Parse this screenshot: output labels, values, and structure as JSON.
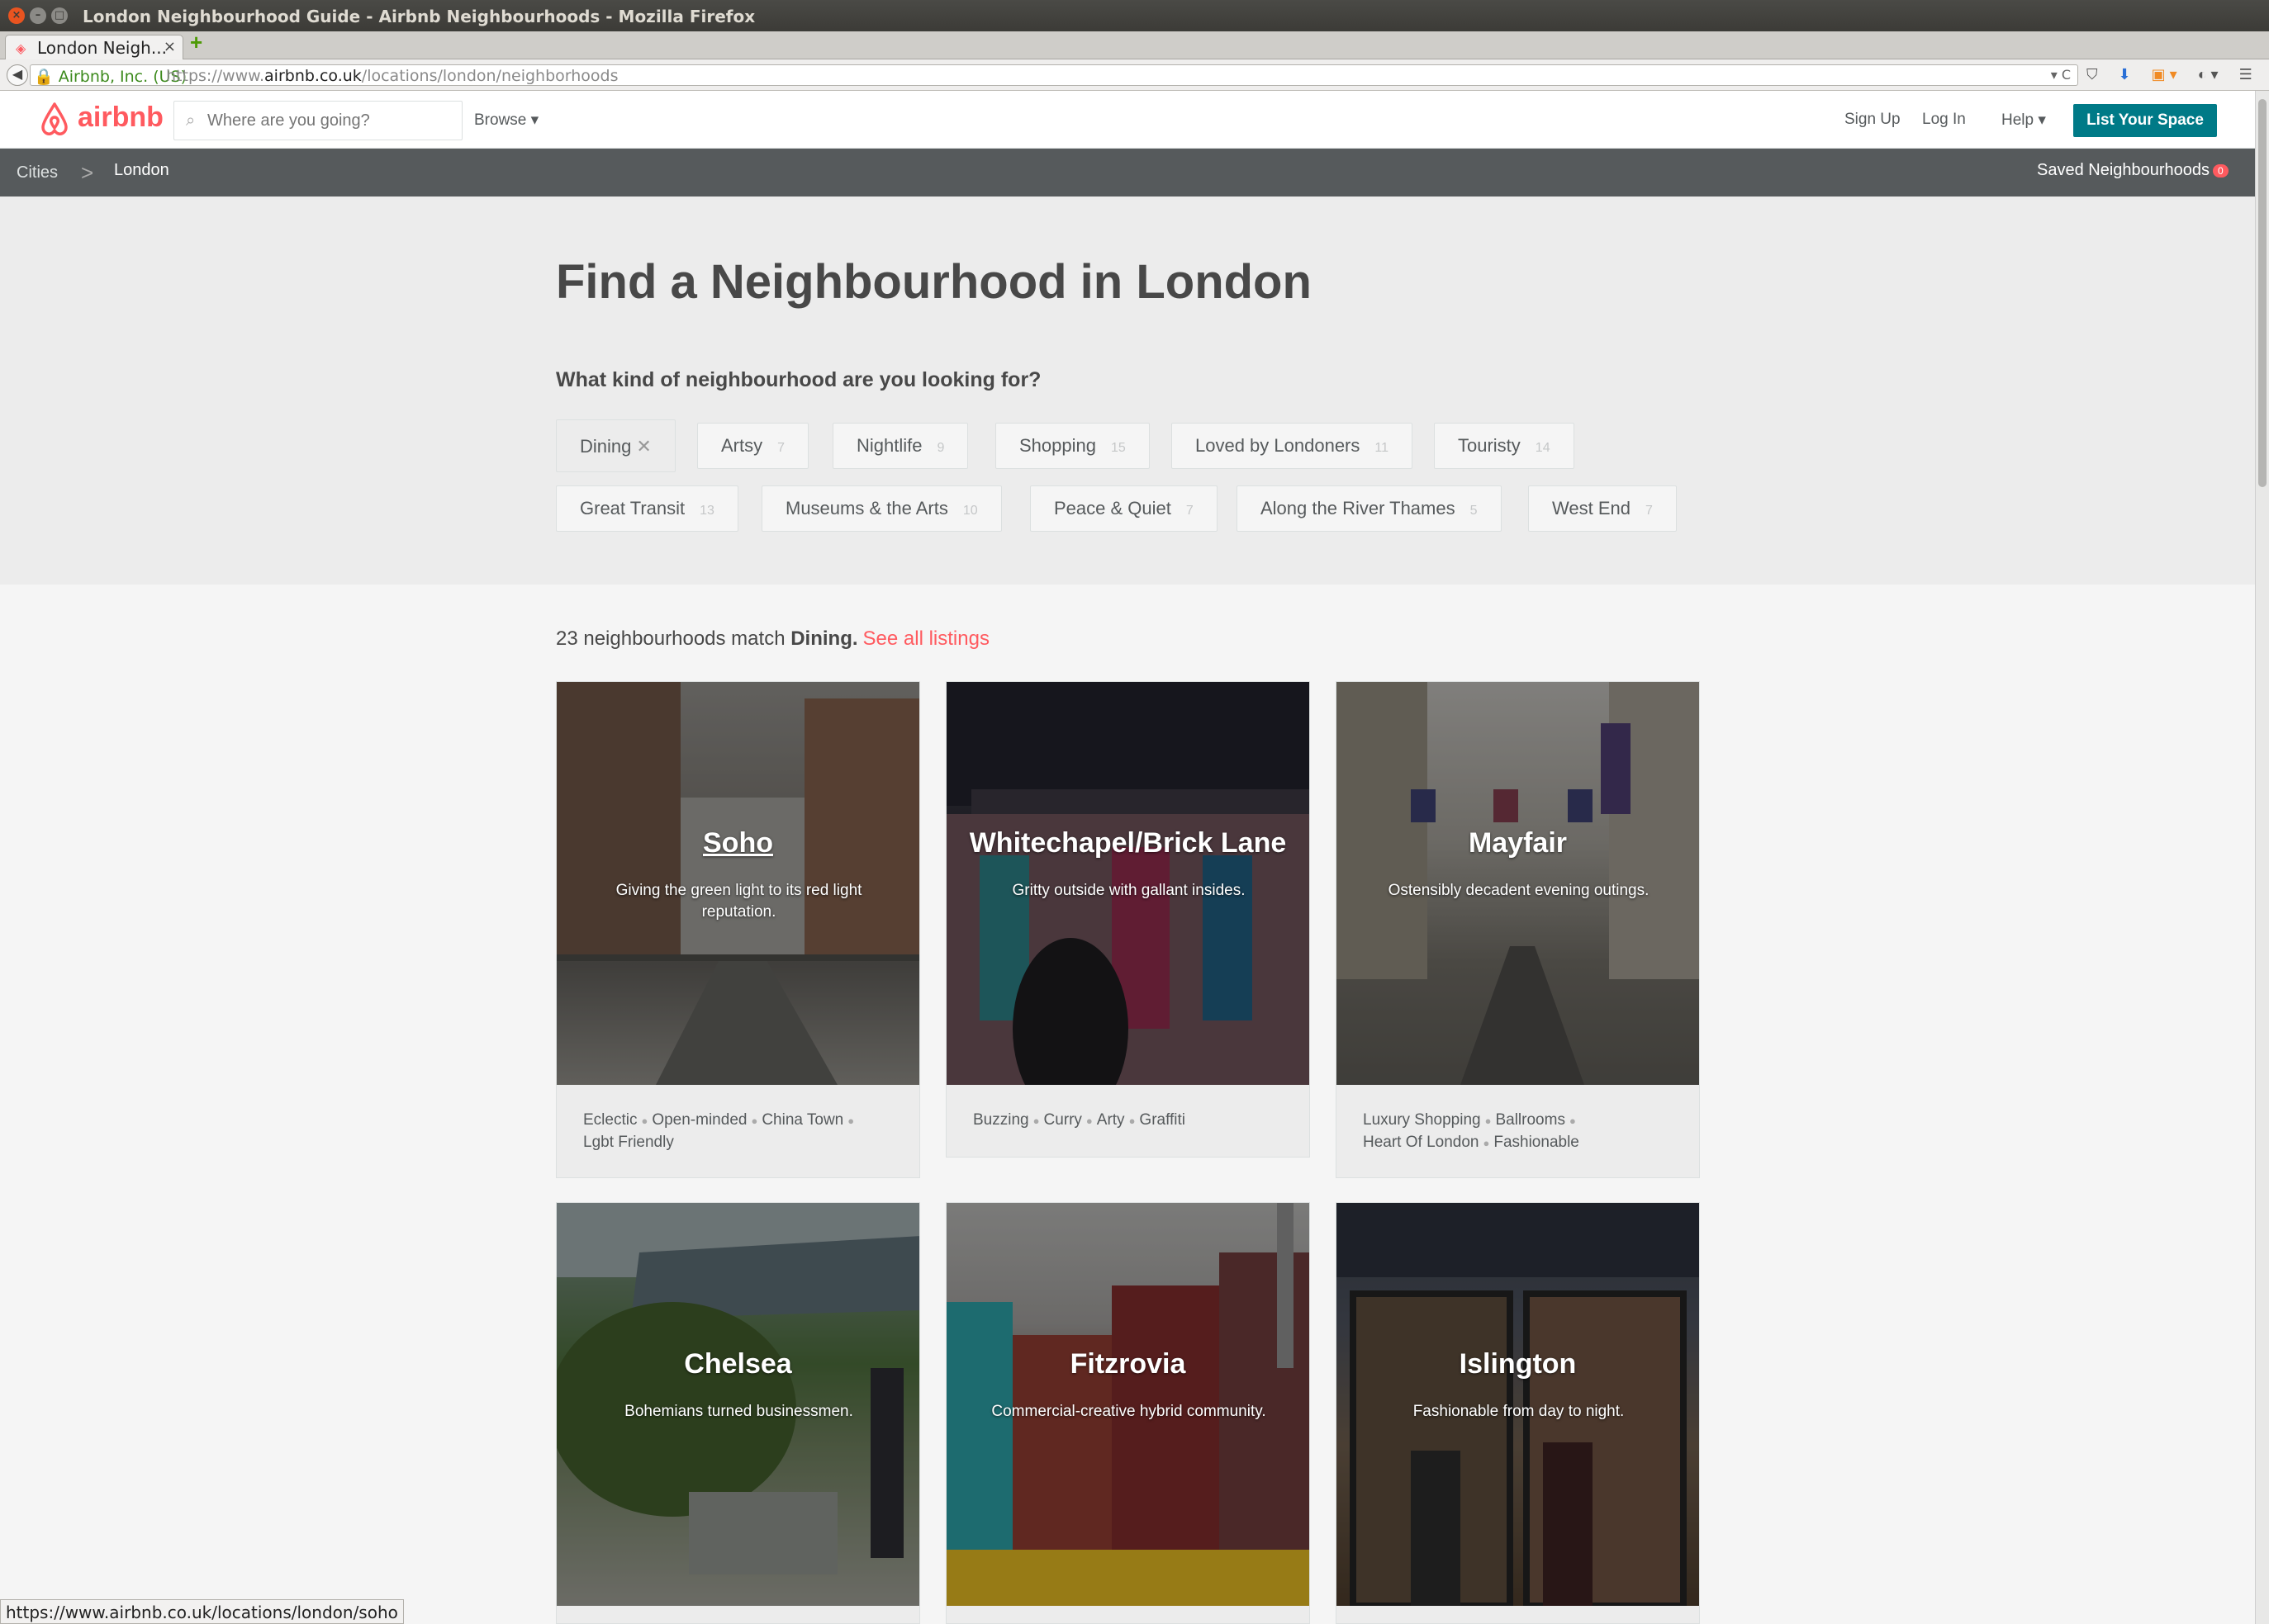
{
  "window": {
    "title": "London Neighbourhood Guide - Airbnb Neighbourhoods - Mozilla Firefox",
    "controls": [
      "×",
      "–",
      "□"
    ]
  },
  "browser": {
    "tab_title": "London Neigh...",
    "tab_close": "×",
    "new_tab": "+",
    "back": "◀",
    "identity": "🔒 Airbnb, Inc. (US)",
    "url_prefix": "https://www.",
    "url_domain": "airbnb.co.uk",
    "url_path": "/locations/london/neighborhoods",
    "url_tail": "▾ C",
    "icons": [
      "pocket-icon",
      "download-icon",
      "rss-icon",
      "addon-icon",
      "menu-icon"
    ],
    "icon_glyphs": [
      "⛉",
      "⬇",
      "▣ ▾",
      "◐ ▾",
      "☰"
    ],
    "status_url": "https://www.airbnb.co.uk/locations/london/soho"
  },
  "header": {
    "logo_text": "airbnb",
    "search_placeholder": "Where are you going?",
    "browse": "Browse ▾",
    "sign_up": "Sign Up",
    "log_in": "Log In",
    "help": "Help ▾",
    "list_space": "List Your Space",
    "brand_color": "#ff5a5f",
    "accent_color": "#007a87"
  },
  "subnav": {
    "crumb_cities": "Cities",
    "separator": ">",
    "crumb_london": "London",
    "saved": "Saved Neighbourhoods",
    "saved_count": "0"
  },
  "hero": {
    "title": "Find a Neighbourhood in London",
    "question": "What kind of neighbourhood are you looking for?",
    "filters": [
      {
        "label": "Dining",
        "count": "",
        "active": true,
        "remove": "✕"
      },
      {
        "label": "Artsy",
        "count": "7"
      },
      {
        "label": "Nightlife",
        "count": "9"
      },
      {
        "label": "Shopping",
        "count": "15"
      },
      {
        "label": "Loved by Londoners",
        "count": "11"
      },
      {
        "label": "Touristy",
        "count": "14"
      },
      {
        "label": "Great Transit",
        "count": "13"
      },
      {
        "label": "Museums & the Arts",
        "count": "10"
      },
      {
        "label": "Peace & Quiet",
        "count": "7"
      },
      {
        "label": "Along the River Thames",
        "count": "5"
      },
      {
        "label": "West End",
        "count": "7"
      }
    ]
  },
  "results": {
    "count_text": "23 neighbourhoods match",
    "filter_bold": "Dining.",
    "see_all": "See all listings",
    "cards": [
      {
        "name": "Soho",
        "desc": "Giving the green light to its red light reputation.",
        "tags": [
          "Eclectic",
          "Open-minded",
          "China Town",
          "Lgbt Friendly"
        ]
      },
      {
        "name": "Whitechapel/Brick Lane",
        "desc": "Gritty outside with gallant insides.",
        "tags": [
          "Buzzing",
          "Curry",
          "Arty",
          "Graffiti"
        ]
      },
      {
        "name": "Mayfair",
        "desc": "Ostensibly decadent evening outings.",
        "tags": [
          "Luxury Shopping",
          "Ballrooms",
          "Heart Of London",
          "Fashionable"
        ]
      },
      {
        "name": "Chelsea",
        "desc": "Bohemians turned businessmen.",
        "tags": []
      },
      {
        "name": "Fitzrovia",
        "desc": "Commercial-creative hybrid community.",
        "tags": []
      },
      {
        "name": "Islington",
        "desc": "Fashionable from day to night.",
        "tags": []
      }
    ]
  }
}
